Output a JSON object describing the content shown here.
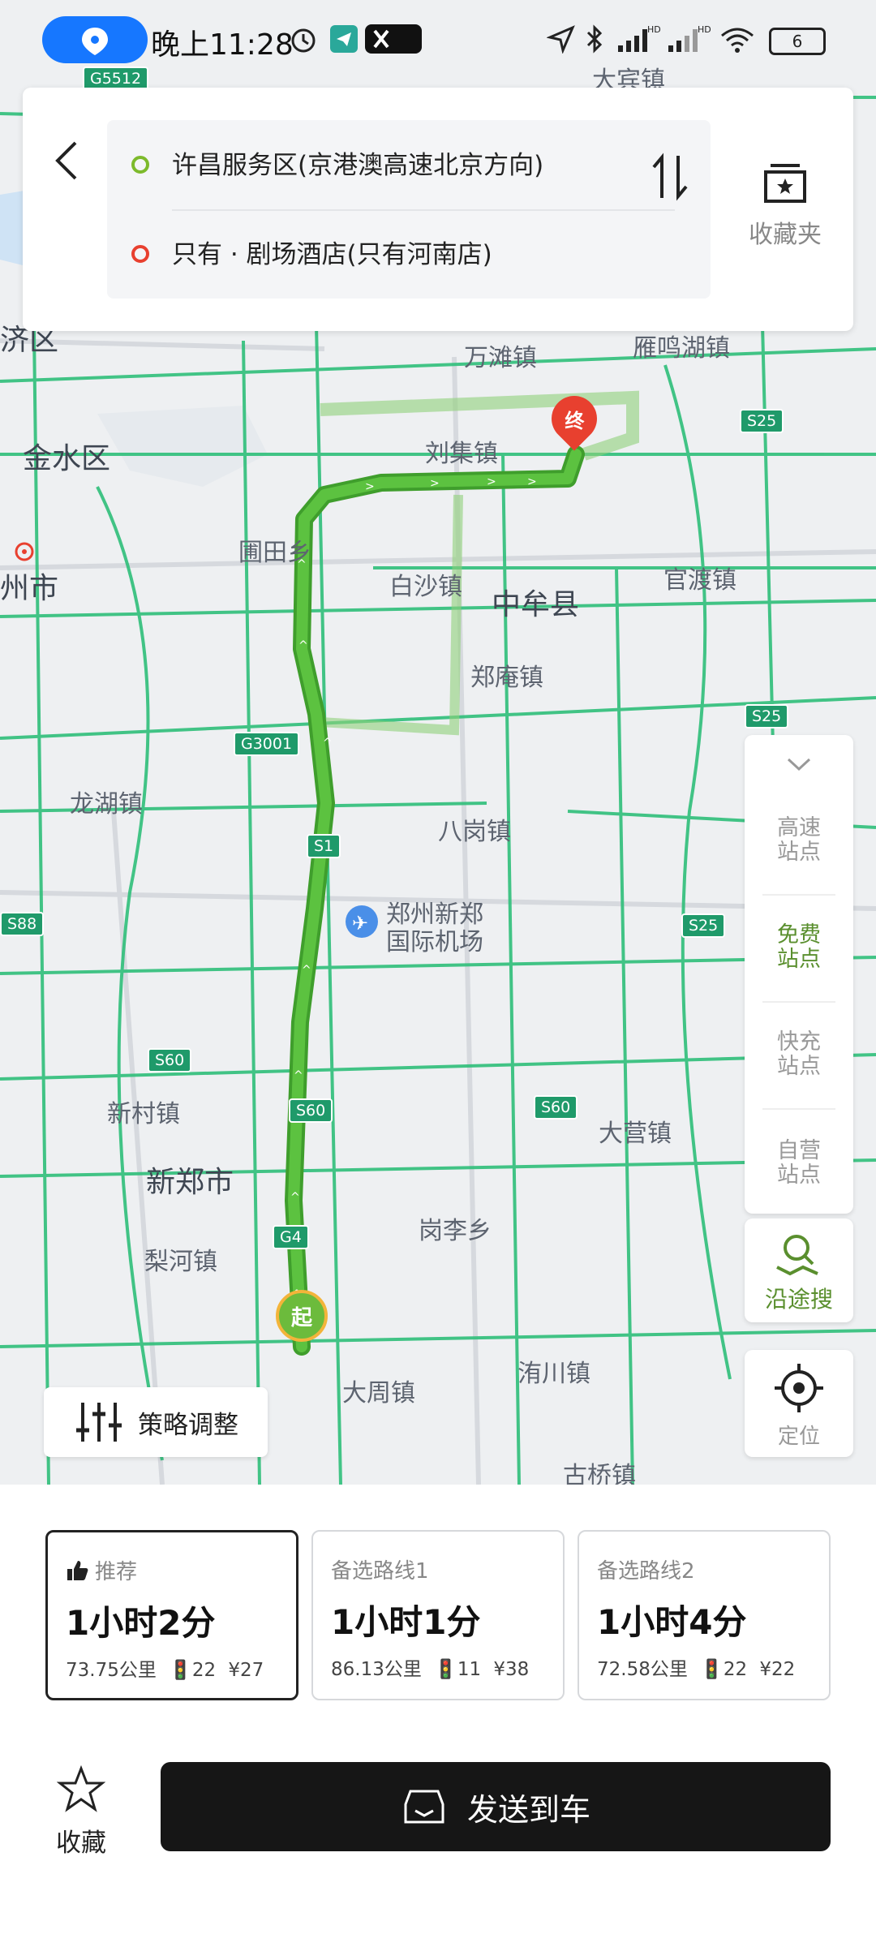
{
  "status_bar": {
    "time": "晚上11:28",
    "battery": "6",
    "icons": [
      "location-pill-icon",
      "alarm-icon",
      "telegram-icon",
      "x-app-icon",
      "navigation-arrow-icon",
      "bluetooth-icon",
      "signal-hd-icon",
      "signal-hd2-icon",
      "wifi-icon",
      "battery-icon"
    ]
  },
  "route_card": {
    "origin": "许昌服务区(京港澳高速北京方向)",
    "destination": "只有 · 剧场酒店(只有河南店)",
    "favorites_label": "收藏夹",
    "origin_color": "#7dba2c",
    "destination_color": "#e8402f"
  },
  "map": {
    "labels": {
      "dabin": "大宾镇",
      "wantan": "万滩镇",
      "yanminghu": "雁鸣湖镇",
      "jinshui": "金水区",
      "liuji": "刘集镇",
      "putian": "圃田乡",
      "baisha": "白沙镇",
      "zhongmou": "中牟县",
      "guandu": "官渡镇",
      "zhengzhou": "州市",
      "zhengan": "郑庵镇",
      "ji": "济区",
      "longhu": "龙湖镇",
      "bagang": "八岗镇",
      "airport_line1": "郑州新郑",
      "airport_line2": "国际机场",
      "xincun": "新村镇",
      "dayingzhen": "大营镇",
      "xinzheng": "新郑市",
      "ganglixiang": "岗李乡",
      "lihe": "梨河镇",
      "dazhou": "大周镇",
      "weichuan": "洧川镇",
      "guqiao": "古桥镇"
    },
    "shields": {
      "g5512": "G5512",
      "s25a": "S25",
      "g3001": "G3001",
      "s25b": "S25",
      "s1": "S1",
      "s25c": "S25",
      "s88": "S88",
      "s60a": "S60",
      "s60b": "S60",
      "s60c": "S60",
      "g4": "G4"
    },
    "start_marker": "起",
    "end_marker": "终",
    "route_color": "#4caf3a"
  },
  "side_panel": {
    "items": [
      {
        "line1": "高速",
        "line2": "站点",
        "active": false
      },
      {
        "line1": "免费",
        "line2": "站点",
        "active": true
      },
      {
        "line1": "快充",
        "line2": "站点",
        "active": false
      },
      {
        "line1": "自营",
        "line2": "站点",
        "active": false
      }
    ],
    "along_search": "沿途搜",
    "locate": "定位",
    "accent": "#4c8a2a"
  },
  "strategy_button": "策略调整",
  "routes": [
    {
      "label": "推荐",
      "duration": "1小时2分",
      "distance": "73.75公里",
      "lights": "22",
      "toll": "¥27",
      "selected": true
    },
    {
      "label": "备选路线1",
      "duration": "1小时1分",
      "distance": "86.13公里",
      "lights": "11",
      "toll": "¥38",
      "selected": false
    },
    {
      "label": "备选路线2",
      "duration": "1小时4分",
      "distance": "72.58公里",
      "lights": "22",
      "toll": "¥22",
      "selected": false
    }
  ],
  "footer": {
    "favorite_label": "收藏",
    "send_label": "发送到车"
  }
}
